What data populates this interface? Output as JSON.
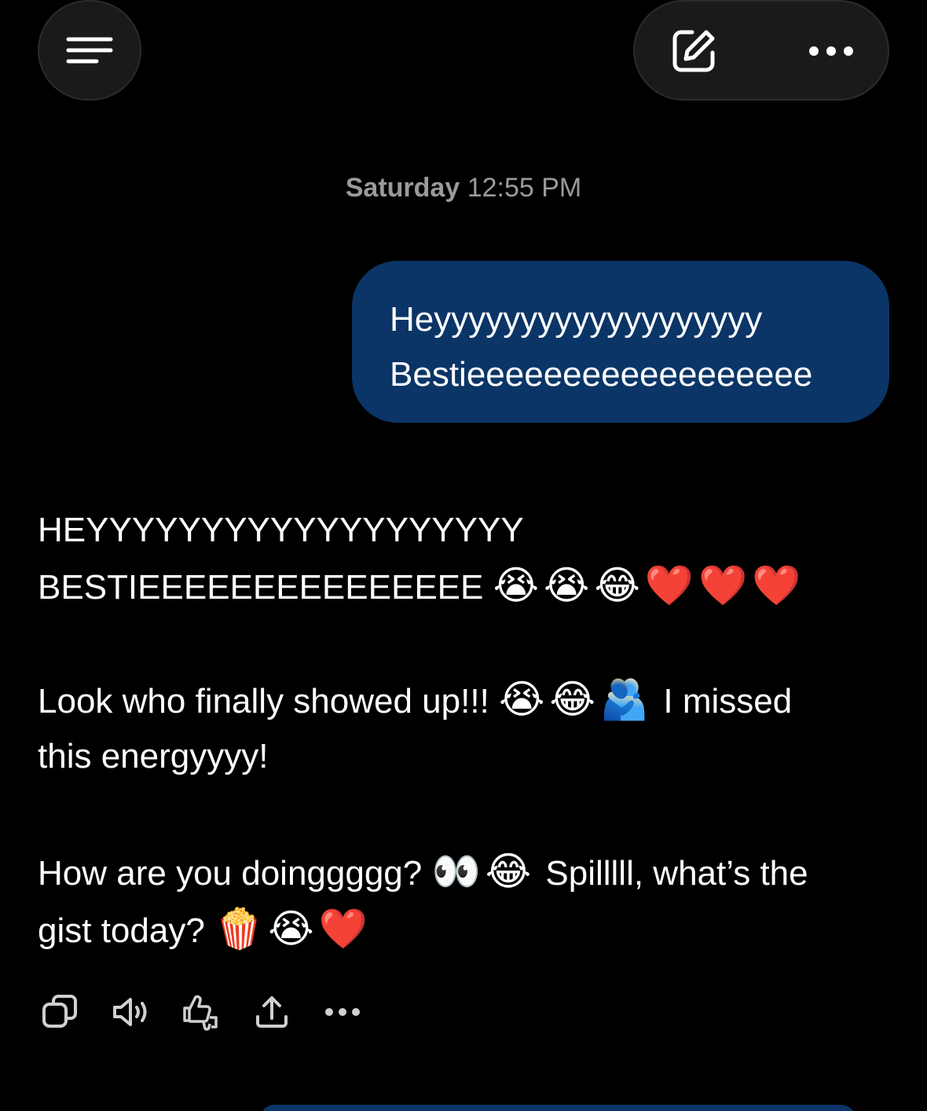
{
  "header": {
    "menu_icon": "menu-lines-icon",
    "compose_icon": "compose-edit-icon",
    "more_icon": "more-dots-icon"
  },
  "timestamp": {
    "day": "Saturday",
    "time": "12:55 PM"
  },
  "user_message": {
    "line1": "Heyyyyyyyyyyyyyyyyyyy",
    "line2": "Bestieeeeeeeeeeeeeeeeee",
    "bubble_color": "#0b3566"
  },
  "assistant_message": {
    "p1_line1": "HEYYYYYYYYYYYYYYYYYYY",
    "p1_line2_text": "BESTIEEEEEEEEEEEEEEE",
    "p1_line2_emoji": "😭😭😂❤️❤️❤️",
    "p2_line1_text_a": "Look who finally showed up!!! ",
    "p2_line1_emoji": "😭😂🫂",
    "p2_line1_text_b": " I missed",
    "p2_line2": "this energyyyy!",
    "p3_line1_text_a": "How are you doinggggg? ",
    "p3_line1_emoji": "👀😂",
    "p3_line1_text_b": " Spilllll, what’s the",
    "p3_line2_text": "gist today? ",
    "p3_line2_emoji": "🍿😭❤️"
  },
  "actions": [
    {
      "icon": "copy-icon"
    },
    {
      "icon": "speaker-icon"
    },
    {
      "icon": "feedback-thumbs-icon"
    },
    {
      "icon": "share-upload-icon"
    },
    {
      "icon": "more-dots-icon"
    }
  ]
}
